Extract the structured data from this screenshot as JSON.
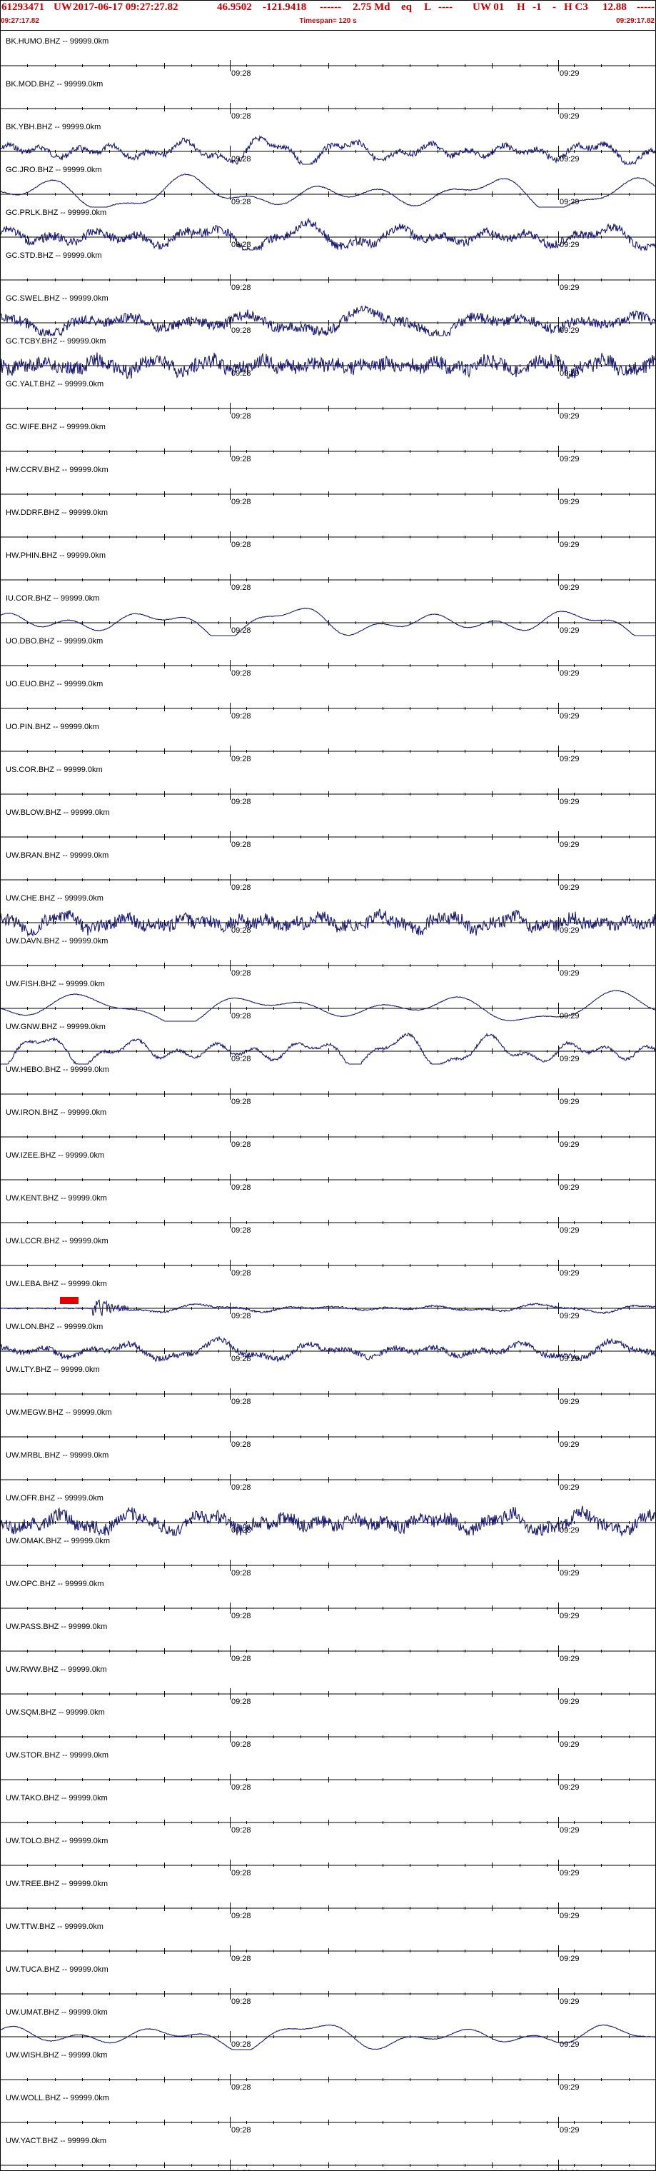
{
  "header": {
    "event_id": "61293471",
    "network": "UW",
    "datetime": "2017-06-17 09:27:27.82",
    "lat": "46.9502",
    "lon": "-121.9418",
    "depth": "------",
    "magnitude": "2.75 Md",
    "type": "eq",
    "flag": "L",
    "dashes": "----",
    "auth": "UW 01",
    "h1": "H",
    "h2": "-1",
    "dash2": "-",
    "h3": "H C3",
    "value": "12.88",
    "tail": "-----",
    "start_time": "09:27:17.82",
    "timespan": "Timespan= 120 s",
    "end_time": "09:29:17.82"
  },
  "time_marks": [
    "09:28",
    "09:29"
  ],
  "colors": {
    "header_text": "#d00000",
    "trace": "#1a1a6e",
    "pick": "#e00000",
    "axis": "#000000"
  },
  "traces": [
    {
      "label": "BK.HUMO.BHZ -- 99999.0km",
      "amp": 0,
      "freq": 0,
      "noise": 0
    },
    {
      "label": "BK.MOD.BHZ -- 99999.0km",
      "amp": 0,
      "freq": 0,
      "noise": 0
    },
    {
      "label": "BK.YBH.BHZ -- 99999.0km",
      "amp": 16,
      "freq": 0.055,
      "noise": 4
    },
    {
      "label": "GC.JRO.BHZ -- 99999.0km",
      "amp": 22,
      "freq": 0.03,
      "noise": 0.6
    },
    {
      "label": "GC.PRLK.BHZ -- 99999.0km",
      "amp": 16,
      "freq": 0.045,
      "noise": 6
    },
    {
      "label": "GC.STD.BHZ -- 99999.0km",
      "amp": 0,
      "freq": 0,
      "noise": 0
    },
    {
      "label": "GC.SWEL.BHZ -- 99999.0km",
      "amp": 15,
      "freq": 0.035,
      "noise": 7
    },
    {
      "label": "GC.TCBY.BHZ -- 99999.0km",
      "amp": 8,
      "freq": 0.08,
      "noise": 10
    },
    {
      "label": "GC.YALT.BHZ -- 99999.0km",
      "amp": 0,
      "freq": 0,
      "noise": 0
    },
    {
      "label": "GC.WIFE.BHZ -- 99999.0km",
      "amp": 0,
      "freq": 0,
      "noise": 0
    },
    {
      "label": "HW.CCRV.BHZ -- 99999.0km",
      "amp": 0,
      "freq": 0,
      "noise": 0
    },
    {
      "label": "HW.DDRF.BHZ -- 99999.0km",
      "amp": 0,
      "freq": 0,
      "noise": 0
    },
    {
      "label": "HW.PHIN.BHZ -- 99999.0km",
      "amp": 0,
      "freq": 0,
      "noise": 0
    },
    {
      "label": "IU.COR.BHZ -- 99999.0km",
      "amp": 20,
      "freq": 0.032,
      "noise": 0.4
    },
    {
      "label": "UO.DBO.BHZ -- 99999.0km",
      "amp": 0,
      "freq": 0,
      "noise": 0
    },
    {
      "label": "UO.EUO.BHZ -- 99999.0km",
      "amp": 0,
      "freq": 0,
      "noise": 0
    },
    {
      "label": "UO.PIN.BHZ -- 99999.0km",
      "amp": 0,
      "freq": 0,
      "noise": 0
    },
    {
      "label": "US.COR.BHZ -- 99999.0km",
      "amp": 0,
      "freq": 0,
      "noise": 0
    },
    {
      "label": "UW.BLOW.BHZ -- 99999.0km",
      "amp": 0,
      "freq": 0,
      "noise": 0
    },
    {
      "label": "UW.BRAN.BHZ -- 99999.0km",
      "amp": 0,
      "freq": 0,
      "noise": 0
    },
    {
      "label": "UW.CHE.BHZ -- 99999.0km",
      "amp": 10,
      "freq": 0.07,
      "noise": 9
    },
    {
      "label": "UW.DAVN.BHZ -- 99999.0km",
      "amp": 0,
      "freq": 0,
      "noise": 0
    },
    {
      "label": "UW.FISH.BHZ -- 99999.0km",
      "amp": 20,
      "freq": 0.025,
      "noise": 0.4
    },
    {
      "label": "UW.GNW.BHZ -- 99999.0km",
      "amp": 20,
      "freq": 0.05,
      "noise": 2
    },
    {
      "label": "UW.HEBO.BHZ -- 99999.0km",
      "amp": 0,
      "freq": 0,
      "noise": 0
    },
    {
      "label": "UW.IRON.BHZ -- 99999.0km",
      "amp": 0,
      "freq": 0,
      "noise": 0
    },
    {
      "label": "UW.IZEE.BHZ -- 99999.0km",
      "amp": 0,
      "freq": 0,
      "noise": 0
    },
    {
      "label": "UW.KENT.BHZ -- 99999.0km",
      "amp": 0,
      "freq": 0,
      "noise": 0
    },
    {
      "label": "UW.LCCR.BHZ -- 99999.0km",
      "amp": 0,
      "freq": 0,
      "noise": 0
    },
    {
      "label": "UW.LEBA.BHZ -- 99999.0km",
      "amp": 5,
      "freq": 0.04,
      "noise": 1.2,
      "pick": true
    },
    {
      "label": "UW.LON.BHZ -- 99999.0km",
      "amp": 12,
      "freq": 0.045,
      "noise": 4
    },
    {
      "label": "UW.LTY.BHZ -- 99999.0km",
      "amp": 0,
      "freq": 0,
      "noise": 0
    },
    {
      "label": "UW.MEGW.BHZ -- 99999.0km",
      "amp": 0,
      "freq": 0,
      "noise": 0
    },
    {
      "label": "UW.MRBL.BHZ -- 99999.0km",
      "amp": 0,
      "freq": 0,
      "noise": 0
    },
    {
      "label": "UW.OFR.BHZ -- 99999.0km",
      "amp": 12,
      "freq": 0.06,
      "noise": 9
    },
    {
      "label": "UW.OMAK.BHZ -- 99999.0km",
      "amp": 0,
      "freq": 0,
      "noise": 0
    },
    {
      "label": "UW.OPC.BHZ -- 99999.0km",
      "amp": 0,
      "freq": 0,
      "noise": 0
    },
    {
      "label": "UW.PASS.BHZ -- 99999.0km",
      "amp": 0,
      "freq": 0,
      "noise": 0
    },
    {
      "label": "UW.RWW.BHZ -- 99999.0km",
      "amp": 0,
      "freq": 0,
      "noise": 0
    },
    {
      "label": "UW.SQM.BHZ -- 99999.0km",
      "amp": 0,
      "freq": 0,
      "noise": 0
    },
    {
      "label": "UW.STOR.BHZ -- 99999.0km",
      "amp": 0,
      "freq": 0,
      "noise": 0
    },
    {
      "label": "UW.TAKO.BHZ -- 99999.0km",
      "amp": 0,
      "freq": 0,
      "noise": 0
    },
    {
      "label": "UW.TOLO.BHZ -- 99999.0km",
      "amp": 0,
      "freq": 0,
      "noise": 0
    },
    {
      "label": "UW.TREE.BHZ -- 99999.0km",
      "amp": 0,
      "freq": 0,
      "noise": 0
    },
    {
      "label": "UW.TTW.BHZ -- 99999.0km",
      "amp": 0,
      "freq": 0,
      "noise": 0
    },
    {
      "label": "UW.TUCA.BHZ -- 99999.0km",
      "amp": 0,
      "freq": 0,
      "noise": 0
    },
    {
      "label": "UW.UMAT.BHZ -- 99999.0km",
      "amp": 18,
      "freq": 0.03,
      "noise": 0.4
    },
    {
      "label": "UW.WISH.BHZ -- 99999.0km",
      "amp": 0,
      "freq": 0,
      "noise": 0
    },
    {
      "label": "UW.WOLL.BHZ -- 99999.0km",
      "amp": 0,
      "freq": 0,
      "noise": 0
    },
    {
      "label": "UW.YACT.BHZ -- 99999.0km",
      "amp": 0,
      "freq": 0,
      "noise": 0
    }
  ]
}
